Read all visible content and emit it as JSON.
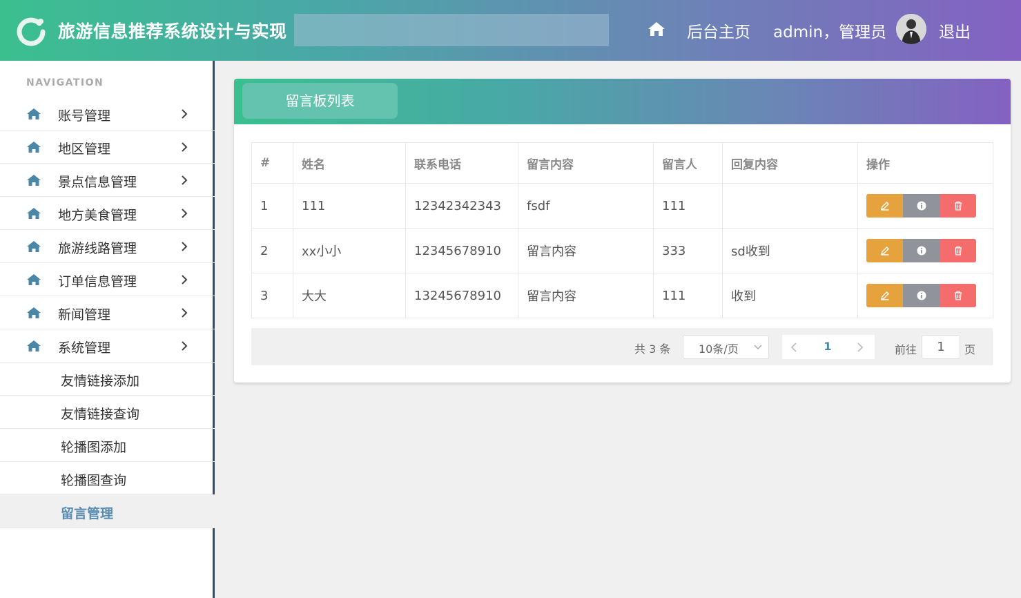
{
  "header": {
    "app_title": "旅游信息推荐系统设计与实现",
    "home_label": "后台主页",
    "user_label": "admin，管理员",
    "logout_label": "退出"
  },
  "sidebar": {
    "heading": "NAVIGATION",
    "items": [
      {
        "label": "账号管理",
        "icon": "home-icon"
      },
      {
        "label": "地区管理",
        "icon": "home-icon"
      },
      {
        "label": "景点信息管理",
        "icon": "home-icon"
      },
      {
        "label": "地方美食管理",
        "icon": "home-icon"
      },
      {
        "label": "旅游线路管理",
        "icon": "home-icon"
      },
      {
        "label": "订单信息管理",
        "icon": "home-icon"
      },
      {
        "label": "新闻管理",
        "icon": "home-icon"
      },
      {
        "label": "系统管理",
        "icon": "home-icon"
      }
    ],
    "subitems": [
      {
        "label": "友情链接添加"
      },
      {
        "label": "友情链接查询"
      },
      {
        "label": "轮播图添加"
      },
      {
        "label": "轮播图查询"
      },
      {
        "label": "留言管理",
        "active": true
      }
    ]
  },
  "panel": {
    "tab_label": "留言板列表"
  },
  "table": {
    "columns": [
      "#",
      "姓名",
      "联系电话",
      "留言内容",
      "留言人",
      "回复内容",
      "操作"
    ],
    "rows": [
      [
        "1",
        "111",
        "12342342343",
        "fsdf",
        "111",
        ""
      ],
      [
        "2",
        "xx小小",
        "12345678910",
        "留言内容",
        "333",
        "sd收到"
      ],
      [
        "3",
        "大大",
        "13245678910",
        "留言内容",
        "111",
        "收到"
      ]
    ],
    "actions": [
      "edit-icon",
      "info-icon",
      "delete-icon"
    ]
  },
  "pagination": {
    "total_text": "共 3 条",
    "page_size": "10条/页",
    "current_page": "1",
    "goto_label": "前往",
    "goto_value": "1",
    "goto_suffix": "页"
  },
  "colors": {
    "header_gradient_start": "#3bbf8f",
    "header_gradient_end": "#8461c2",
    "active_nav": "#5a8cb0",
    "edit_button": "#e6a23c",
    "info_button": "#909399",
    "delete_button": "#f56c6c"
  }
}
